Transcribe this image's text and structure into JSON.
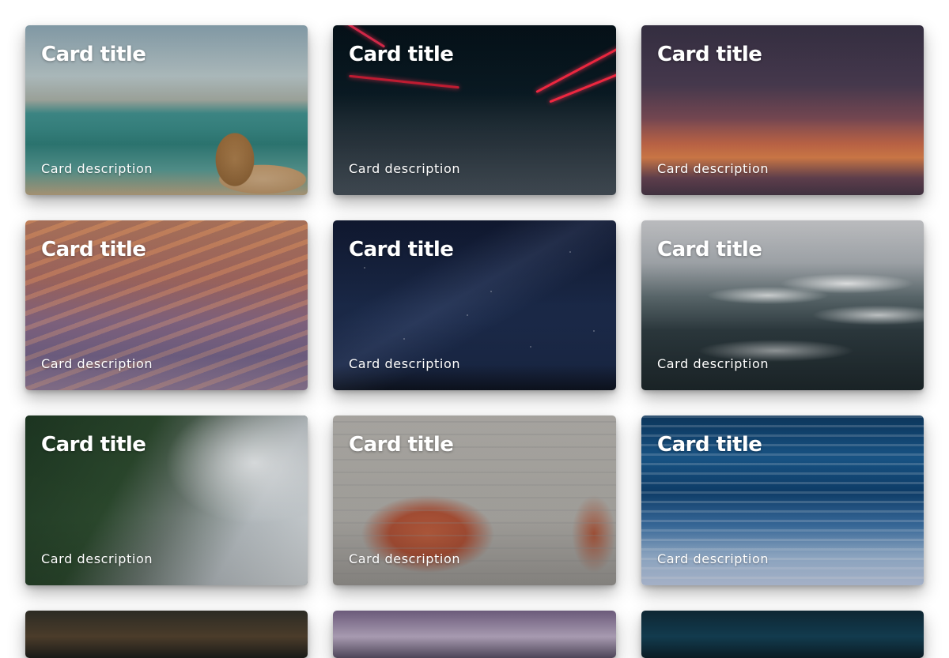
{
  "cards": [
    {
      "title": "Card title",
      "description": "Card description",
      "image": "coastline-sea-stacks"
    },
    {
      "title": "Card title",
      "description": "Card description",
      "image": "night-road-light-trails"
    },
    {
      "title": "Card title",
      "description": "Card description",
      "image": "sunset-sky"
    },
    {
      "title": "Card title",
      "description": "Card description",
      "image": "mountain-range-sunset"
    },
    {
      "title": "Card title",
      "description": "Card description",
      "image": "starry-night-sky"
    },
    {
      "title": "Card title",
      "description": "Card description",
      "image": "clouds-over-valley"
    },
    {
      "title": "Card title",
      "description": "Card description",
      "image": "foggy-forest-mountain"
    },
    {
      "title": "Card title",
      "description": "Card description",
      "image": "cracked-brick-wall"
    },
    {
      "title": "Card title",
      "description": "Card description",
      "image": "ocean-long-exposure"
    }
  ],
  "colors": {
    "background": "#ffffff",
    "text": "#ffffff"
  }
}
